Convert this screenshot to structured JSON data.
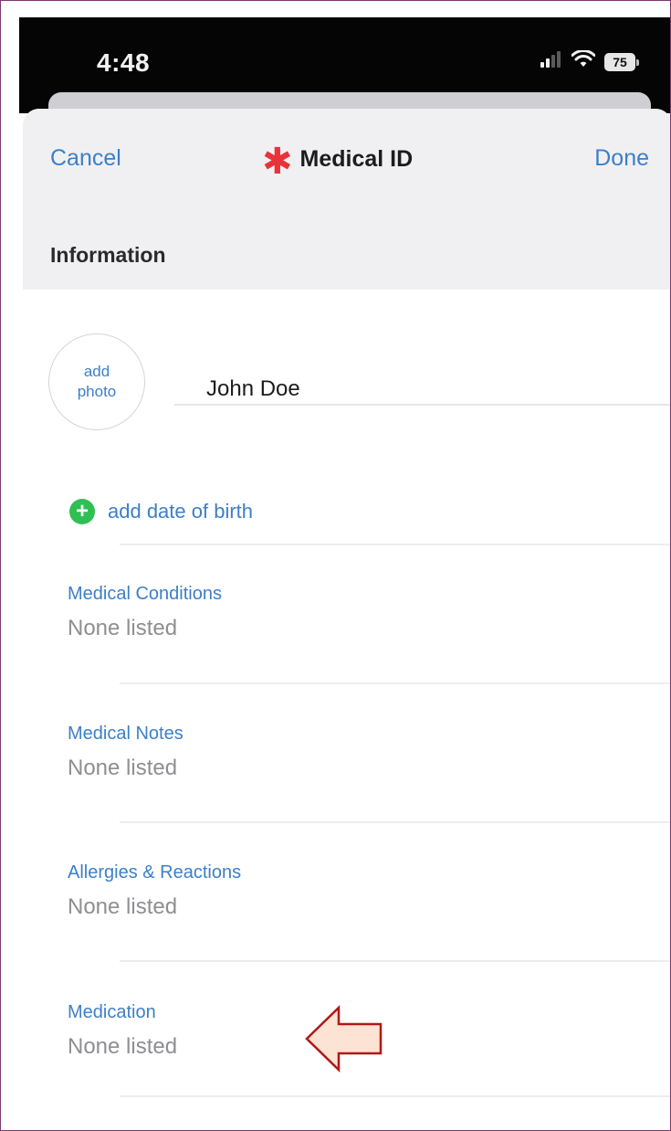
{
  "status_bar": {
    "time": "4:48",
    "signal_icon": "cellular-signal-icon",
    "wifi_icon": "wifi-icon",
    "battery_level": "75"
  },
  "nav": {
    "cancel_label": "Cancel",
    "title": "Medical ID",
    "title_icon": "medical-asterisk-icon",
    "done_label": "Done"
  },
  "section": {
    "title": "Information"
  },
  "profile": {
    "photo_line1": "add",
    "photo_line2": "photo",
    "name_value": "John Doe"
  },
  "dob": {
    "icon": "plus-circle-icon",
    "label": "add date of birth"
  },
  "fields": [
    {
      "label": "Medical Conditions",
      "value": "None listed"
    },
    {
      "label": "Medical Notes",
      "value": "None listed"
    },
    {
      "label": "Allergies & Reactions",
      "value": "None listed"
    },
    {
      "label": "Medication",
      "value": "None listed"
    }
  ],
  "annotation": {
    "icon": "left-arrow-icon",
    "fill_color": "#fde3d3",
    "stroke_color": "#b01818"
  },
  "colors": {
    "accent": "#3d7fc7",
    "medical_red": "#e8333a",
    "add_green": "#2fbf52",
    "placeholder_gray": "#8e8e93",
    "frame_border": "#7a3a6e"
  }
}
